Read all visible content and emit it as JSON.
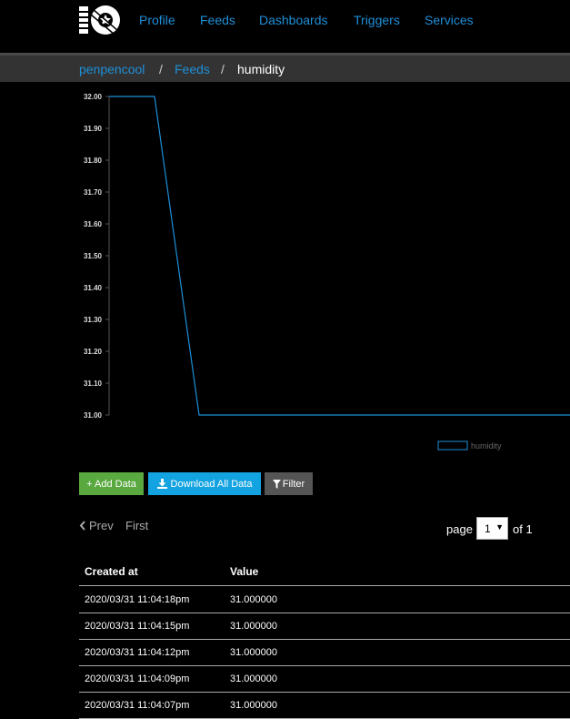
{
  "nav": {
    "logo": "io",
    "links": [
      "Profile",
      "Feeds",
      "Dashboards",
      "Triggers",
      "Services"
    ]
  },
  "breadcrumb": {
    "user": "penpencool",
    "section": "Feeds",
    "current": "humidity",
    "separator": "/"
  },
  "chart_data": {
    "type": "line",
    "series": [
      {
        "name": "humidity",
        "color": "#1e8fd8"
      }
    ],
    "x": [
      "2020/03/31 11:04:07pm",
      "2020/03/31 11:04:09pm",
      "2020/03/31 11:04:12pm",
      "2020/03/31 11:04:15pm",
      "2020/03/31 11:04:18pm"
    ],
    "y_points_visual": [
      32.0,
      32.0,
      31.0,
      31.0,
      31.0
    ],
    "ylim": [
      31.0,
      32.0
    ],
    "yticks": [
      "32.00",
      "31.90",
      "31.80",
      "31.70",
      "31.60",
      "31.50",
      "31.40",
      "31.30",
      "31.20",
      "31.10",
      "31.00"
    ],
    "legend": [
      "humidity"
    ],
    "legend_placement": "bottom-right",
    "grid": false
  },
  "actions": {
    "add": "+ Add Data",
    "download": "Download All Data",
    "filter": "Filter"
  },
  "pagination": {
    "prev": "Prev",
    "first": "First",
    "page_label": "page",
    "page_value": "1",
    "of_label": "of 1"
  },
  "table": {
    "headers": [
      "Created at",
      "Value"
    ],
    "rows": [
      [
        "2020/03/31 11:04:18pm",
        "31.000000"
      ],
      [
        "2020/03/31 11:04:15pm",
        "31.000000"
      ],
      [
        "2020/03/31 11:04:12pm",
        "31.000000"
      ],
      [
        "2020/03/31 11:04:09pm",
        "31.000000"
      ],
      [
        "2020/03/31 11:04:07pm",
        "31.000000"
      ]
    ]
  }
}
